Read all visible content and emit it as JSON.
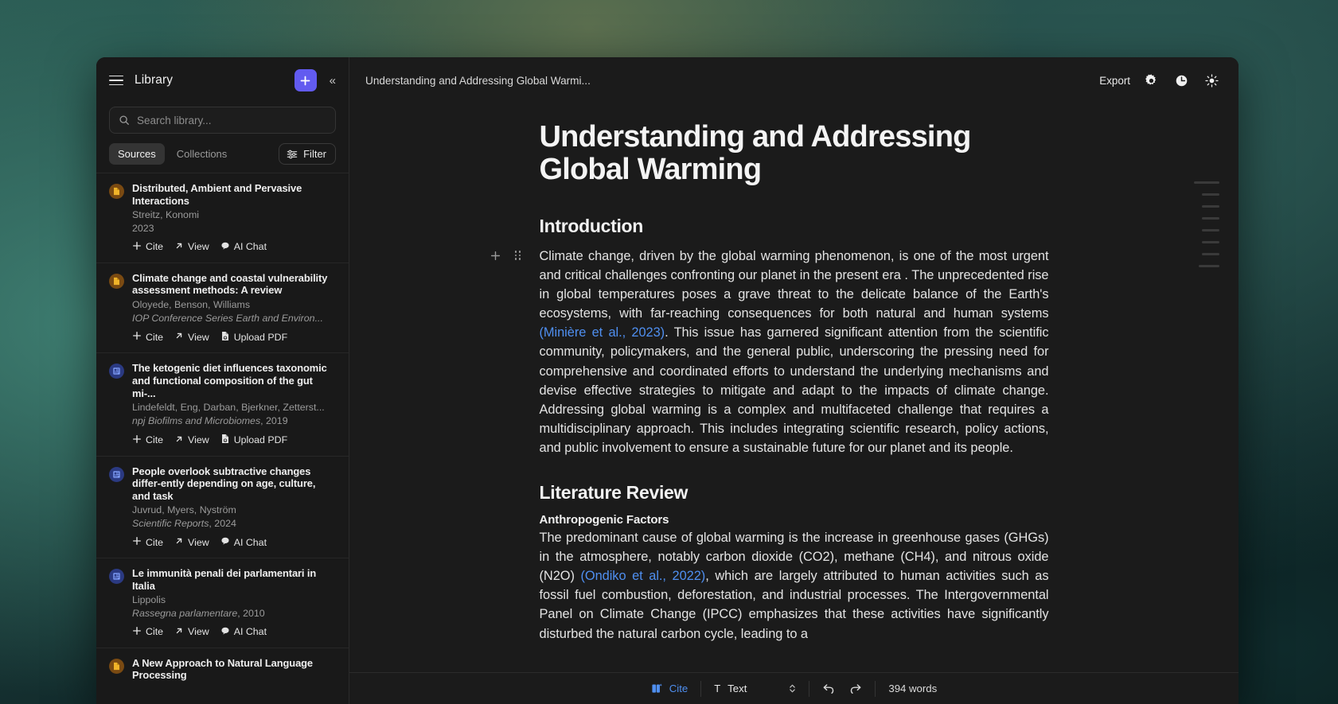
{
  "sidebar": {
    "menu_icon": "hamburger-icon",
    "title": "Library",
    "add_label": "+",
    "collapse_label": "«",
    "search": {
      "placeholder": "Search library...",
      "value": "",
      "icon": "search-icon"
    },
    "tabs": [
      {
        "label": "Sources",
        "active": true
      },
      {
        "label": "Collections",
        "active": false
      }
    ],
    "filter": {
      "label": "Filter",
      "icon": "sliders-icon"
    },
    "sources": [
      {
        "badge": "document-icon",
        "badge_color": "#7a4a12",
        "title": "Distributed, Ambient and Pervasive Interactions",
        "authors": "Streitz, Konomi",
        "venue": "",
        "year": "2023",
        "actions": [
          "Cite",
          "View",
          "AI Chat"
        ]
      },
      {
        "badge": "document-icon",
        "badge_color": "#7a4a12",
        "title": "Climate change and coastal vulnerability assessment methods: A review",
        "authors": "Oloyede, Benson, Williams",
        "venue": "IOP Conference Series Earth and Environ...",
        "year": "",
        "actions": [
          "Cite",
          "View",
          "Upload PDF"
        ]
      },
      {
        "badge": "journal-icon",
        "badge_color": "#2b3a82",
        "title": "The ketogenic diet influences taxonomic and functional composition of the gut mi-...",
        "authors": "Lindefeldt, Eng, Darban, Bjerkner, Zetterst...",
        "venue": "npj Biofilms and Microbiomes",
        "year": "2019",
        "actions": [
          "Cite",
          "View",
          "Upload PDF"
        ]
      },
      {
        "badge": "journal-icon",
        "badge_color": "#2b3a82",
        "title": "People overlook subtractive changes differ-ently depending on age, culture, and task",
        "authors": "Juvrud, Myers, Nyström",
        "venue": "Scientific Reports",
        "year": "2024",
        "actions": [
          "Cite",
          "View",
          "AI Chat"
        ]
      },
      {
        "badge": "journal-icon",
        "badge_color": "#2b3a82",
        "title": "Le immunità penali dei parlamentari in Italia",
        "authors": "Lippolis",
        "venue": "Rassegna parlamentare",
        "year": "2010",
        "actions": [
          "Cite",
          "View",
          "AI Chat"
        ]
      },
      {
        "badge": "document-icon",
        "badge_color": "#7a4a12",
        "title": "A New Approach to Natural Language Processing",
        "authors": "",
        "venue": "",
        "year": "",
        "actions": []
      }
    ]
  },
  "topbar": {
    "doc_tab_title": "Understanding and Addressing Global Warmi...",
    "export_label": "Export",
    "icons": [
      "gear-icon",
      "history-clock-icon",
      "theme-sun-icon"
    ]
  },
  "document": {
    "h1": "Understanding and Addressing Global Warming",
    "intro_heading": "Introduction",
    "intro_p1": "Climate change, driven by the global warming phenomenon, is one of the most urgent and critical challenges confronting our planet in the present era . The unprecedented rise in global temperatures poses a grave threat to the delicate balance of the Earth's ecosystems, with far-reaching consequences for both natural and human systems ",
    "intro_cite": "(Minière et al., 2023)",
    "intro_p2": ". This issue has garnered significant attention from the scientific community, policymakers, and the general public, underscoring the pressing need for comprehensive and coordinated efforts to understand the underlying mechanisms and devise effective strategies to mitigate and adapt to the impacts of climate change. Addressing global warming is a complex and multifaceted challenge that requires a multidisciplinary approach. This includes integrating scientific research, policy actions, and public involvement to ensure a sustainable future for our planet and its people.",
    "lit_heading": "Literature Review",
    "anthro_heading": "Anthropogenic Factors",
    "anthro_p1": "The predominant cause of global warming is the increase in greenhouse gases (GHGs) in the atmosphere, notably carbon dioxide (CO2), methane (CH4), and nitrous oxide (N2O) ",
    "anthro_cite": "(Ondiko et al., 2022)",
    "anthro_p2": ", which are largely attributed to human activities such as fossil fuel combustion, deforestation, and industrial processes. The Intergovernmental Panel on Climate Change (IPCC) emphasizes that these activities have significantly disturbed the natural carbon cycle, leading to a"
  },
  "bottombar": {
    "cite_label": "Cite",
    "text_icon": "T",
    "text_label": "Text",
    "undo_icon": "undo-arrow-icon",
    "redo_icon": "redo-arrow-icon",
    "word_count": "394 words"
  },
  "colors": {
    "accent_purple": "#625bf0",
    "link_blue": "#4f8ff0",
    "badge_amber": "#7a4a12",
    "badge_blue": "#2b3a82"
  }
}
